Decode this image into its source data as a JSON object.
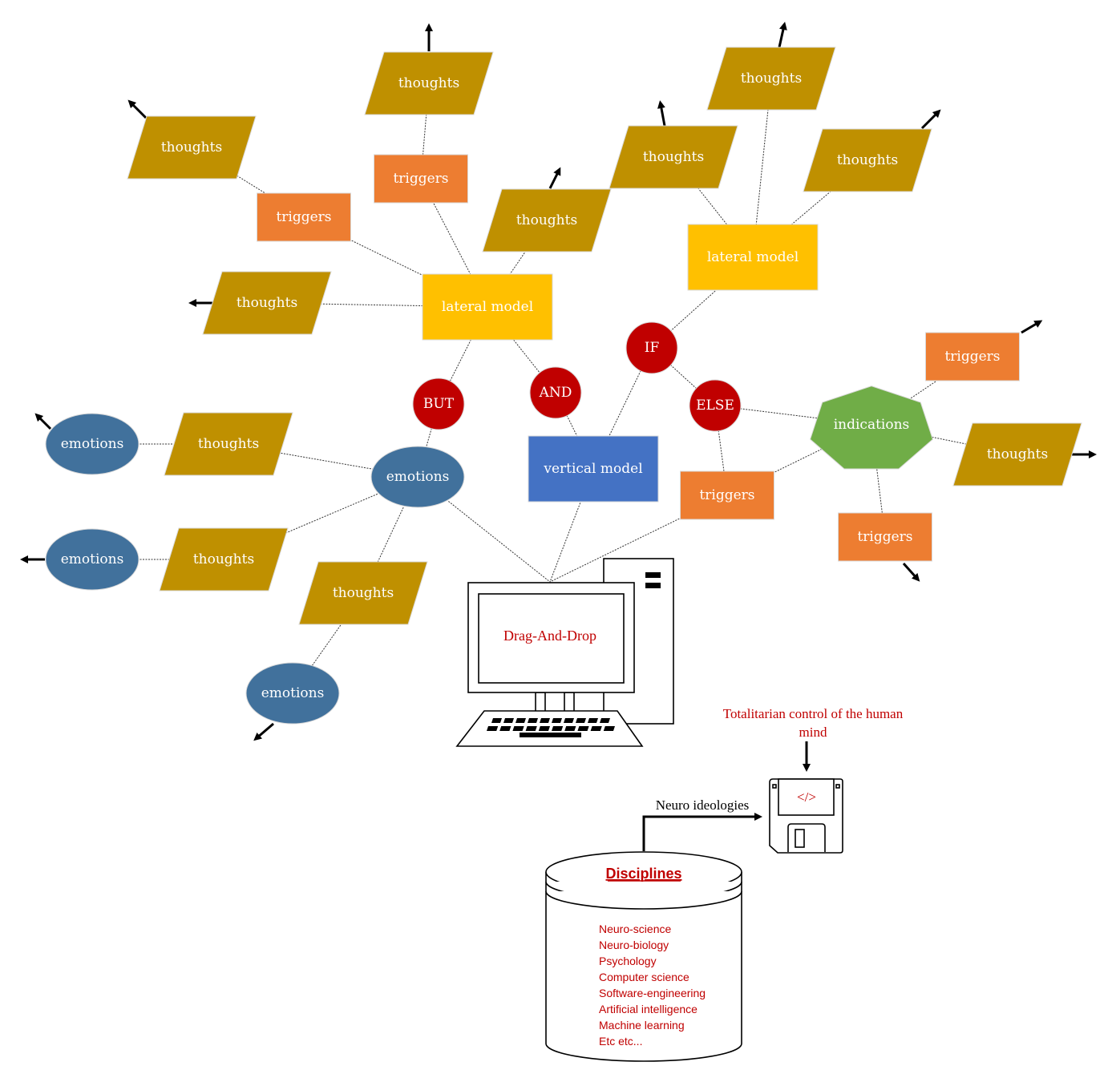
{
  "colors": {
    "thoughts": "#bf9000",
    "triggers": "#ed7d31",
    "lateral_model": "#ffc000",
    "vertical_model": "#4472c4",
    "emotions": "#41719c",
    "logic": "#c00000",
    "indications": "#70ad47",
    "annotation_red": "#c00000"
  },
  "labels": {
    "thoughts": "thoughts",
    "triggers": "triggers",
    "lateral_model": "lateral model",
    "vertical_model": "vertical model",
    "emotions": "emotions",
    "indications": "indications",
    "but": "BUT",
    "and": "AND",
    "if": "IF",
    "else": "ELSE"
  },
  "computer": {
    "screen_text": "Drag-And-Drop"
  },
  "floppy": {
    "caption_line1": "Totalitarian control of the human",
    "caption_line2": "mind",
    "icon_text": "</>",
    "input_label": "Neuro ideologies"
  },
  "database": {
    "title": "Disciplines",
    "items": [
      "Neuro-science",
      "Neuro-biology",
      "Psychology",
      "Computer science",
      "Software-engineering",
      "Artificial intelligence",
      "Machine learning",
      "Etc etc..."
    ]
  }
}
